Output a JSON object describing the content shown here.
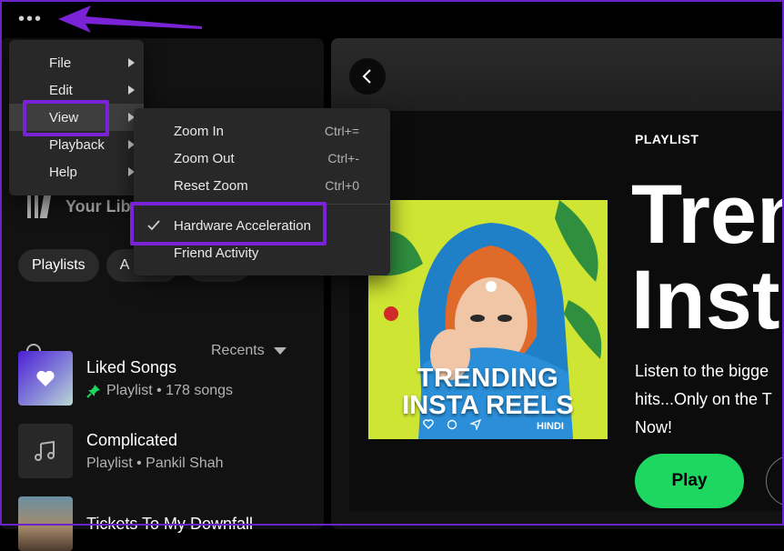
{
  "topbar": {
    "more_label": "•••"
  },
  "main_menu": {
    "items": [
      {
        "label": "File"
      },
      {
        "label": "Edit"
      },
      {
        "label": "View"
      },
      {
        "label": "Playback"
      },
      {
        "label": "Help"
      }
    ]
  },
  "view_submenu": {
    "items": [
      {
        "label": "Zoom In",
        "shortcut": "Ctrl+="
      },
      {
        "label": "Zoom Out",
        "shortcut": "Ctrl+-"
      },
      {
        "label": "Reset Zoom",
        "shortcut": "Ctrl+0"
      },
      {
        "label": "Hardware Acceleration",
        "checked": true
      },
      {
        "label": "Friend Activity"
      }
    ]
  },
  "library": {
    "title": "Your Lib",
    "filters": [
      "Playlists",
      "A"
    ],
    "sort_label": "Recents",
    "items": [
      {
        "title": "Liked Songs",
        "subtitle": "Playlist • 178 songs",
        "pinned": true
      },
      {
        "title": "Complicated",
        "subtitle": "Playlist • Pankil Shah"
      },
      {
        "title": "Tickets To My Downfall",
        "subtitle": ""
      }
    ]
  },
  "hero": {
    "type_label": "PLAYLIST",
    "title_line1": "Tren",
    "title_line2": "Insta",
    "description_line1": "Listen to the bigge",
    "description_line2": "hits...Only on the T",
    "description_line3": "Now!",
    "play_label": "Play",
    "cover": {
      "line1": "TRENDING",
      "line2": "INSTA REELS",
      "line3": "HINDI"
    }
  },
  "colors": {
    "accent_green": "#1ed760",
    "highlight_purple": "#7a22d6",
    "background": "#121212"
  }
}
